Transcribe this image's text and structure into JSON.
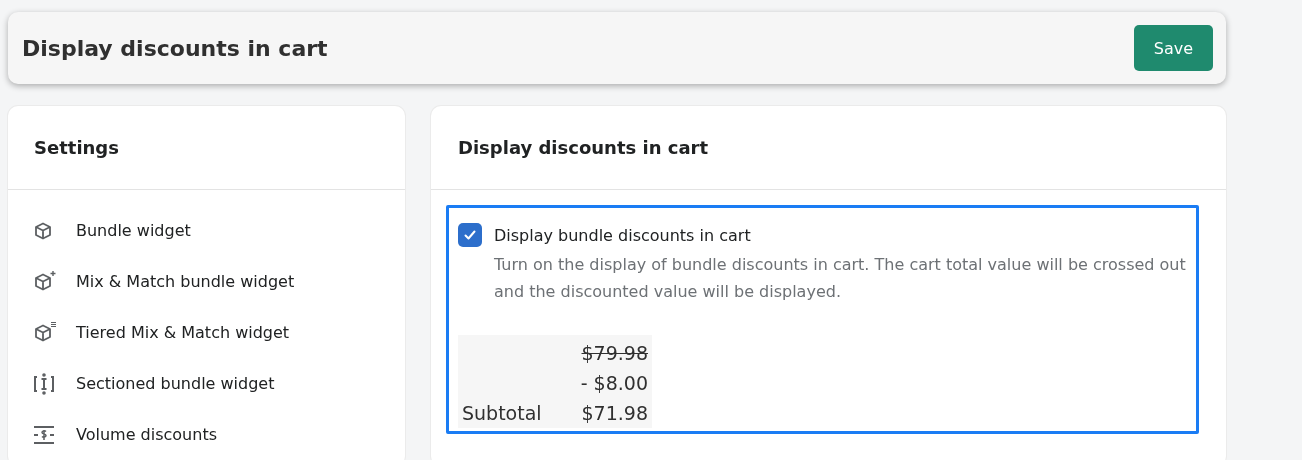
{
  "header": {
    "title": "Display discounts in cart",
    "save_button": "Save"
  },
  "sidebar": {
    "title": "Settings",
    "items": [
      {
        "label": "Bundle widget",
        "kind": "box"
      },
      {
        "label": "Mix & Match bundle widget",
        "kind": "box-plus"
      },
      {
        "label": "Tiered Mix & Match widget",
        "kind": "box-list"
      },
      {
        "label": "Sectioned bundle widget",
        "kind": "sections"
      },
      {
        "label": "Volume discounts",
        "kind": "dollar"
      }
    ]
  },
  "panel": {
    "title": "Display discounts in cart",
    "option": {
      "label": "Display bundle discounts in cart",
      "checked": true,
      "description": "Turn on the display of bundle discounts in cart. The cart total value will be crossed out and the discounted value will be displayed."
    },
    "preview": [
      {
        "value": "$79.98",
        "kind": "original"
      },
      {
        "value": "- $8.00",
        "kind": "discount"
      },
      {
        "label": "Subtotal",
        "value": "$71.98",
        "kind": "total"
      }
    ]
  }
}
